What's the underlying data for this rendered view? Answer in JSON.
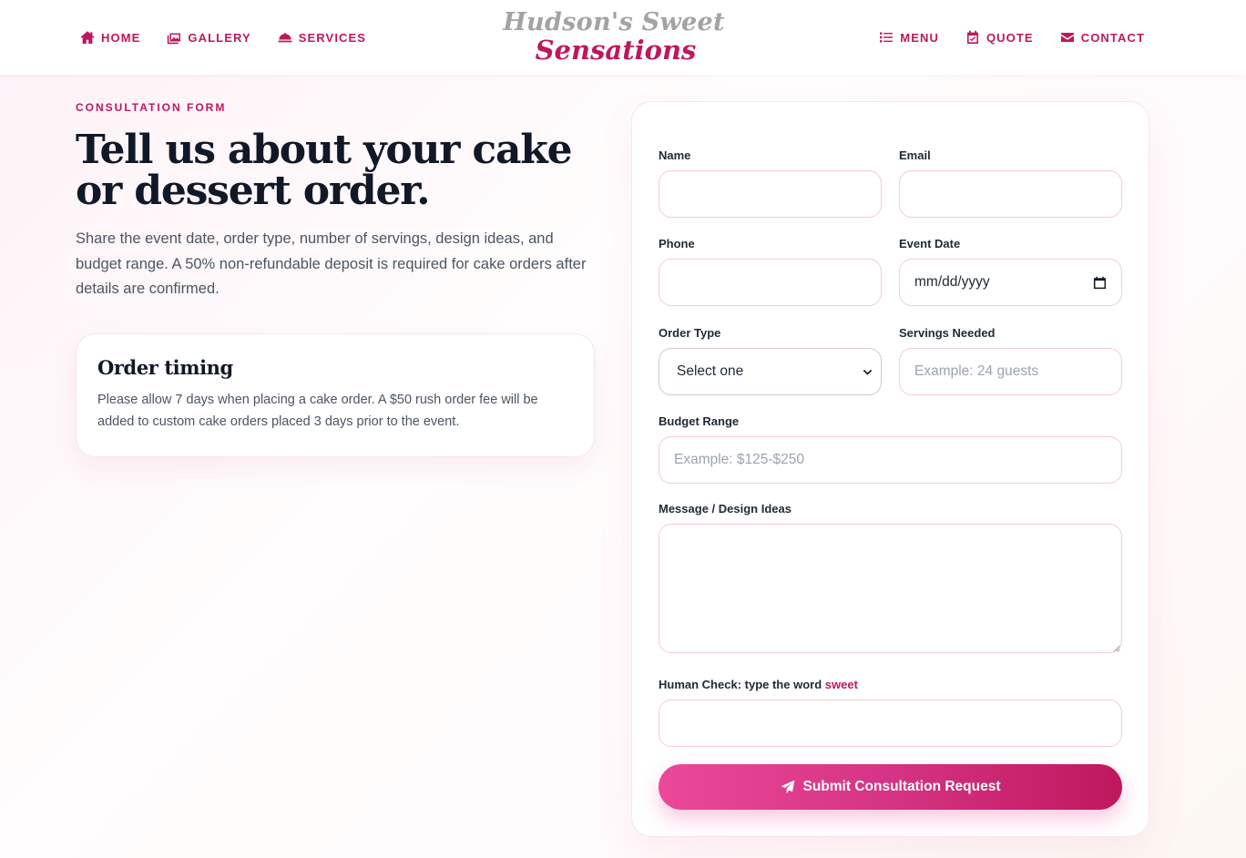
{
  "nav": {
    "left": [
      {
        "label": "HOME",
        "icon": "home-icon"
      },
      {
        "label": "GALLERY",
        "icon": "images-icon"
      },
      {
        "label": "SERVICES",
        "icon": "cloche-icon"
      }
    ],
    "right": [
      {
        "label": "MENU",
        "icon": "list-icon"
      },
      {
        "label": "QUOTE",
        "icon": "calendar-check-icon"
      },
      {
        "label": "CONTACT",
        "icon": "envelope-icon"
      }
    ]
  },
  "logo": {
    "line1": "Hudson's Sweet",
    "line2": "Sensations"
  },
  "intro": {
    "eyebrow": "CONSULTATION FORM",
    "headline": "Tell us about your cake or dessert order.",
    "description": "Share the event date, order type, number of servings, design ideas, and budget range. A 50% non-refundable deposit is required for cake orders after details are confirmed."
  },
  "timing_card": {
    "title": "Order timing",
    "text": "Please allow 7 days when placing a cake order. A $50 rush order fee will be added to custom cake orders placed 3 days prior to the event."
  },
  "form": {
    "name_label": "Name",
    "email_label": "Email",
    "phone_label": "Phone",
    "event_date_label": "Event Date",
    "event_date_placeholder": "mm/dd/yyyy",
    "order_type_label": "Order Type",
    "order_type_selected": "Select one",
    "servings_label": "Servings Needed",
    "servings_placeholder": "Example: 24 guests",
    "budget_label": "Budget Range",
    "budget_placeholder": "Example: $125-$250",
    "message_label": "Message / Design Ideas",
    "human_check_label": "Human Check: type the word",
    "human_check_word": "sweet",
    "submit_label": "Submit Consultation Request"
  },
  "colors": {
    "brand": "#be185d",
    "brand_light": "#ec4899",
    "logo_gray": "#a3a3a3",
    "heading": "#111827"
  }
}
